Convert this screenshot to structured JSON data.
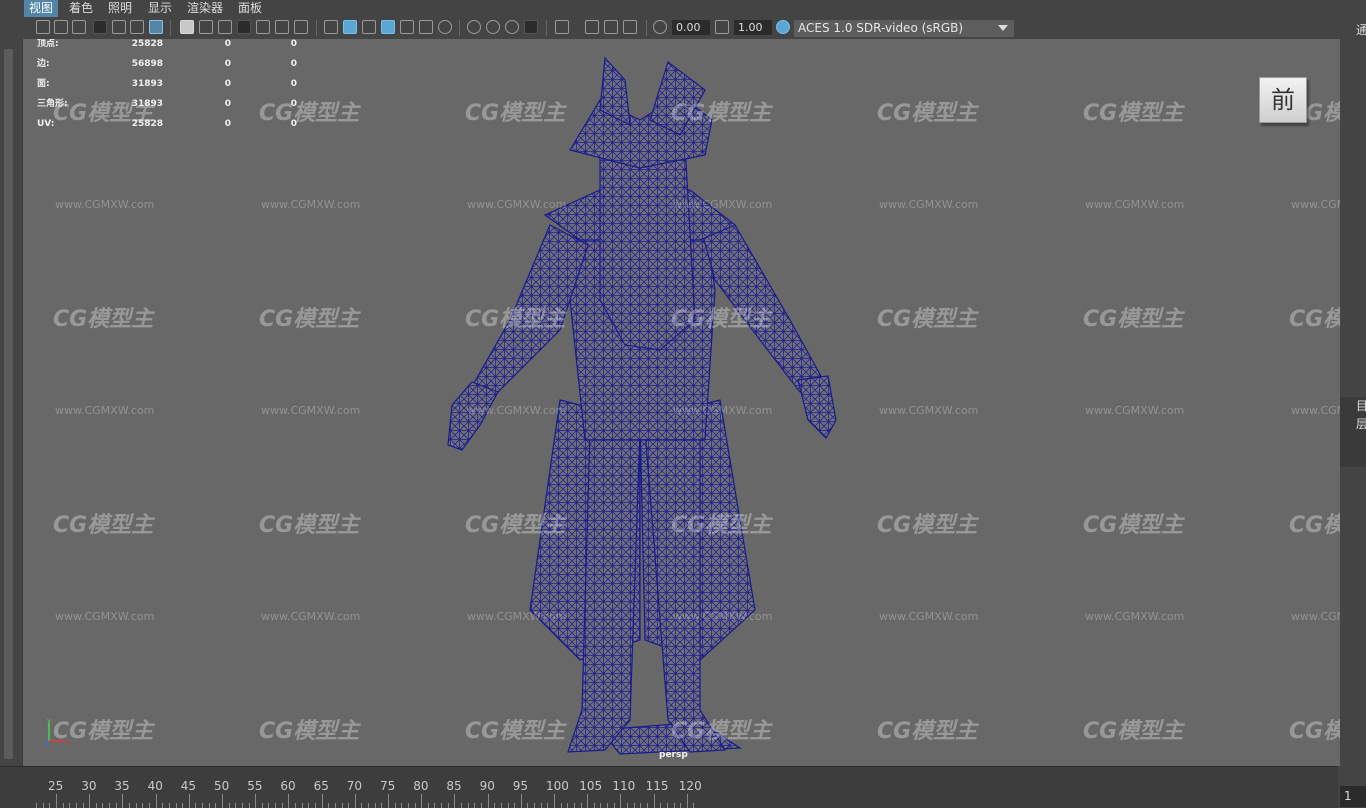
{
  "menubar": {
    "items": [
      "视图",
      "着色",
      "照明",
      "显示",
      "渲染器",
      "面板"
    ]
  },
  "toolbar": {
    "exposure_value": "0.00",
    "gamma_value": "1.00",
    "color_space": "ACES 1.0 SDR-video (sRGB)"
  },
  "hud": {
    "rows": [
      {
        "label": "顶点:",
        "v1": "25828",
        "v2": "0",
        "v3": "0"
      },
      {
        "label": "边:",
        "v1": "56898",
        "v2": "0",
        "v3": "0"
      },
      {
        "label": "面:",
        "v1": "31893",
        "v2": "0",
        "v3": "0"
      },
      {
        "label": "三角形:",
        "v1": "31893",
        "v2": "0",
        "v3": "0"
      },
      {
        "label": "UV:",
        "v1": "25828",
        "v2": "0",
        "v3": "0"
      }
    ]
  },
  "viewport": {
    "view_cube_label": "前",
    "camera_name": "persp",
    "watermark_logo": "CG模型主",
    "watermark_url": "www.CGMXW.com",
    "wire_color": "#1a1a8c",
    "background_color": "#686868"
  },
  "axis_indicator": {
    "x": "x",
    "y": "y",
    "z": "z"
  },
  "right_panel": {
    "text_1": "通",
    "text_2": "目",
    "text_3": "层"
  },
  "timeline": {
    "ticks": [
      "25",
      "30",
      "35",
      "40",
      "45",
      "50",
      "55",
      "60",
      "65",
      "70",
      "75",
      "80",
      "85",
      "90",
      "95",
      "100",
      "105",
      "110",
      "115",
      "120"
    ],
    "current_frame": "1"
  }
}
